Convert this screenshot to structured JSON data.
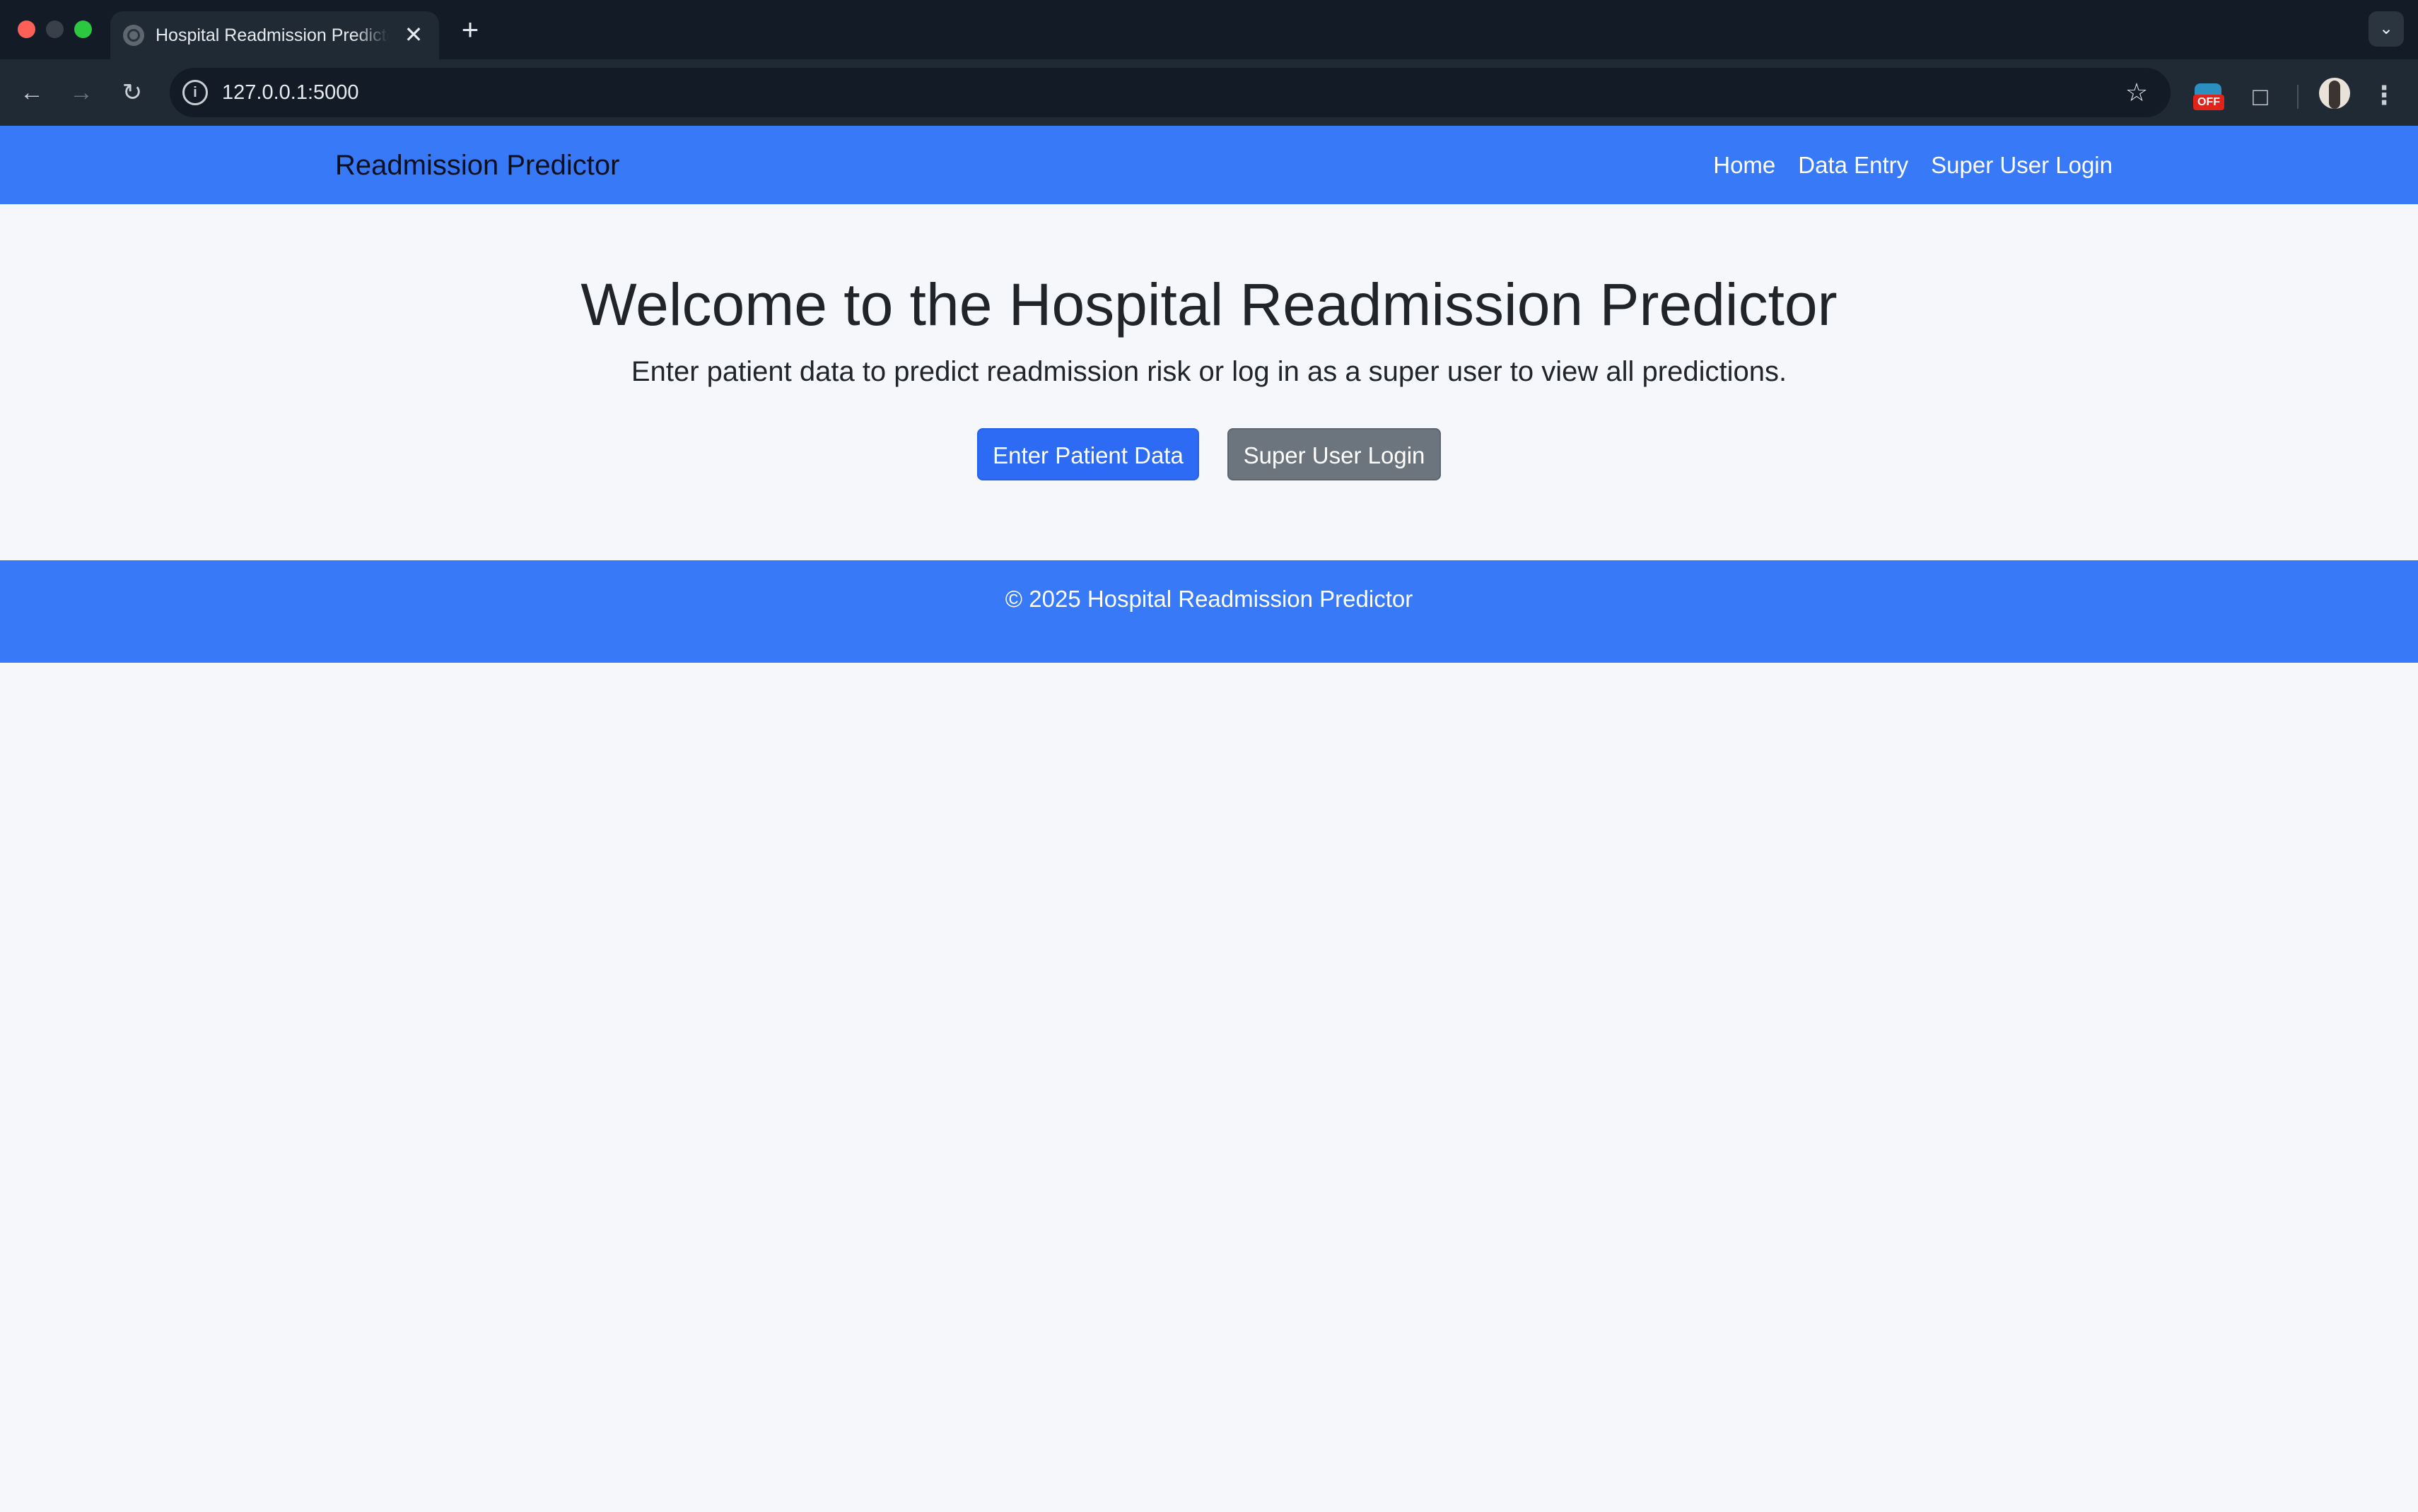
{
  "browser": {
    "tab_title": "Hospital Readmission Predictor",
    "tab_close": "✕",
    "new_tab": "+",
    "url": "127.0.0.1:5000",
    "extension_badge": "OFF"
  },
  "navbar": {
    "brand": "Readmission Predictor",
    "links": [
      {
        "label": "Home"
      },
      {
        "label": "Data Entry"
      },
      {
        "label": "Super User Login"
      }
    ],
    "background_color": "#3779f6"
  },
  "hero": {
    "title": "Welcome to the Hospital Readmission Predictor",
    "subtitle": "Enter patient data to predict readmission risk or log in as a super user to view all predictions.",
    "primary_button": "Enter Patient Data",
    "secondary_button": "Super User Login",
    "primary_color": "#2d6bf5",
    "secondary_color": "#6c757d"
  },
  "footer": {
    "text": "© 2025 Hospital Readmission Predictor"
  },
  "icons": {
    "back": "arrow-left-icon",
    "forward": "arrow-right-icon",
    "reload": "reload-icon",
    "site_info": "info-icon",
    "bookmark": "star-icon",
    "extensions": "puzzle-icon",
    "menu": "kebab-menu-icon",
    "tab_search": "chevron-down-icon"
  }
}
